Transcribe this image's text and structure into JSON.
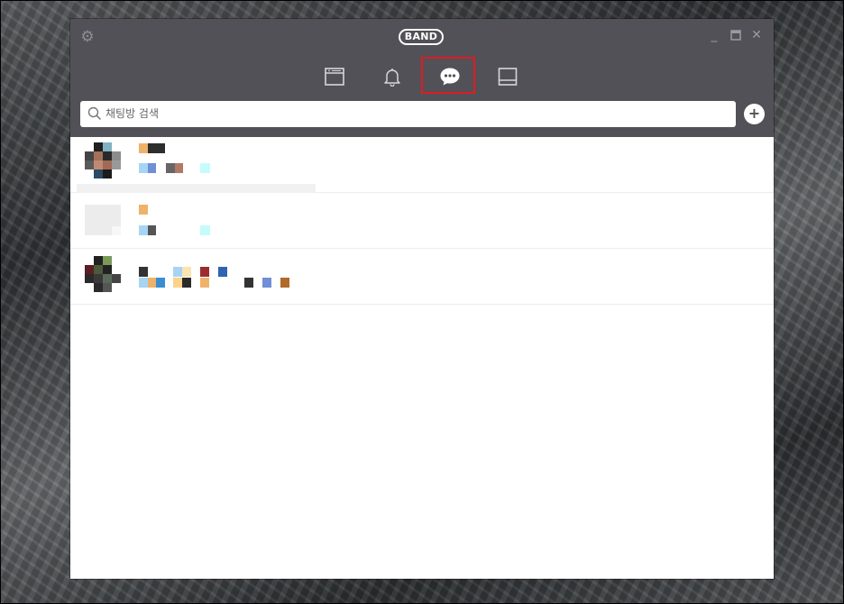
{
  "app": {
    "logo_text": "BAND"
  },
  "titlebar": {
    "settings_icon": "gear-icon",
    "minimize_icon": "minimize-icon",
    "maximize_icon": "maximize-icon",
    "close_icon": "close-icon",
    "minimize_glyph": "_",
    "close_glyph": "✕"
  },
  "tabs": [
    {
      "icon": "band-home-icon",
      "selected": false
    },
    {
      "icon": "bell-icon",
      "selected": false
    },
    {
      "icon": "chat-bubble-icon",
      "selected": true
    },
    {
      "icon": "pages-icon",
      "selected": false
    }
  ],
  "search": {
    "placeholder": "채팅방 검색",
    "value": ""
  },
  "add_button": {
    "label": "+"
  },
  "colors": {
    "titlebar_bg": "#515157",
    "highlight_border": "#e11a22",
    "content_bg": "#ffffff"
  },
  "chat_list": [
    {
      "name": "",
      "preview": "",
      "avatar": "pixelated"
    },
    {
      "name": "",
      "preview": "",
      "avatar": "pixelated"
    },
    {
      "name": "",
      "preview": "",
      "avatar": "pixelated"
    }
  ]
}
